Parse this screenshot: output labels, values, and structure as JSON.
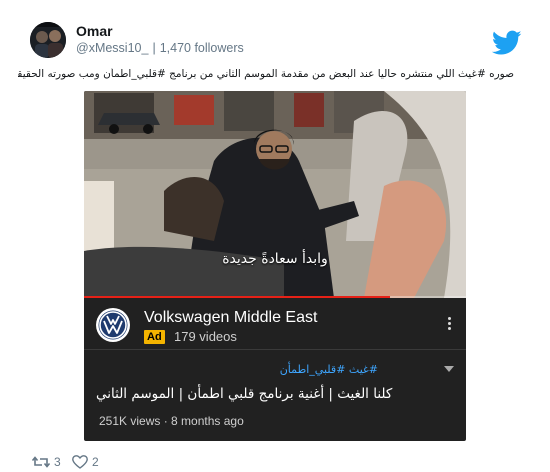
{
  "author": {
    "name": "Omar",
    "handle": "@xMessi10_",
    "followers": "1,470 followers",
    "separator": "|",
    "avatar_icon": "avatar-photo"
  },
  "tweet": {
    "text": "صوره #غيث اللي منتشره حاليا عند البعض من مقدمة الموسم الثاني من برنامج #قلبي_اطمأن ومب صورته الحقيقية"
  },
  "embed": {
    "caption": "وابدأ سعادةً جديدة",
    "progress": 0.8,
    "channel": {
      "name": "Volkswagen Middle East",
      "ad_label": "Ad",
      "video_count": "179 videos",
      "logo_icon": "vw-logo"
    },
    "hashtags": "#غيث #قلبي_اطمأن",
    "title": "كلنا الغيث | أغنية برنامج قلبي اطمأن | الموسم الثاني",
    "stats": "251K views · 8 months ago"
  },
  "actions": {
    "retweets": "3",
    "likes": "2"
  },
  "colors": {
    "twitter_blue": "#1da1f2",
    "ad_yellow": "#f4b400",
    "youtube_red": "#e62117",
    "hashtag_blue": "#3ea6ff"
  }
}
